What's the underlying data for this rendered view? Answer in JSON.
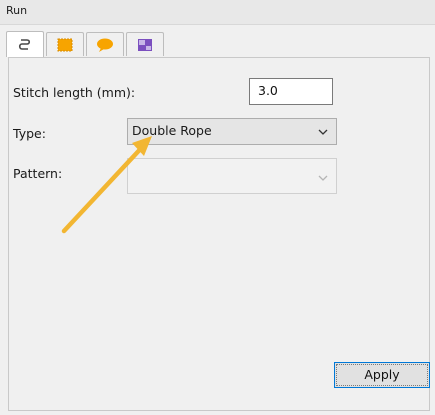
{
  "window": {
    "title": "Run"
  },
  "tabs": [
    {
      "icon": "running-stitch-icon",
      "active": true
    },
    {
      "icon": "fill-stitch-icon",
      "active": false
    },
    {
      "icon": "speech-bubble-icon",
      "active": false
    },
    {
      "icon": "object-properties-icon",
      "active": false
    }
  ],
  "form": {
    "stitch_length_label": "Stitch length (mm):",
    "stitch_length_value": "3.0",
    "type_label": "Type:",
    "type_value": "Double Rope",
    "pattern_label": "Pattern:",
    "pattern_value": ""
  },
  "apply_label": "Apply",
  "colors": {
    "panel_bg": "#f0f0f0",
    "arrow": "#f2b632",
    "tab_icon_orange": "#f7a400",
    "tab_icon_purple": "#7b4fbf",
    "focus_border": "#0078d7"
  }
}
